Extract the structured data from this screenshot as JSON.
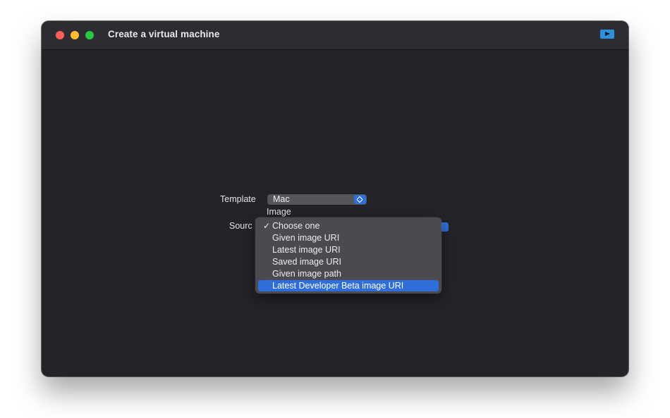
{
  "window": {
    "title": "Create a virtual machine",
    "toolbar_icon": "play-icon"
  },
  "form": {
    "template_label": "Template",
    "template_value": "Mac",
    "image_label": "Image",
    "source_label": "Sourc"
  },
  "source_menu": {
    "checked_item": "Choose one",
    "highlighted_item": "Latest Developer Beta image URI",
    "items": [
      {
        "label": "Choose one"
      },
      {
        "label": "Given image URI"
      },
      {
        "label": "Latest image URI"
      },
      {
        "label": "Saved image URI"
      },
      {
        "label": "Given image path"
      },
      {
        "label": "Latest Developer Beta image URI"
      }
    ]
  },
  "colors": {
    "accent": "#2f6ed8",
    "window_bg": "#232329",
    "titlebar_bg": "#2c2c32",
    "close": "#fe5f57",
    "minimize": "#febc2e",
    "maximize": "#28c840"
  }
}
